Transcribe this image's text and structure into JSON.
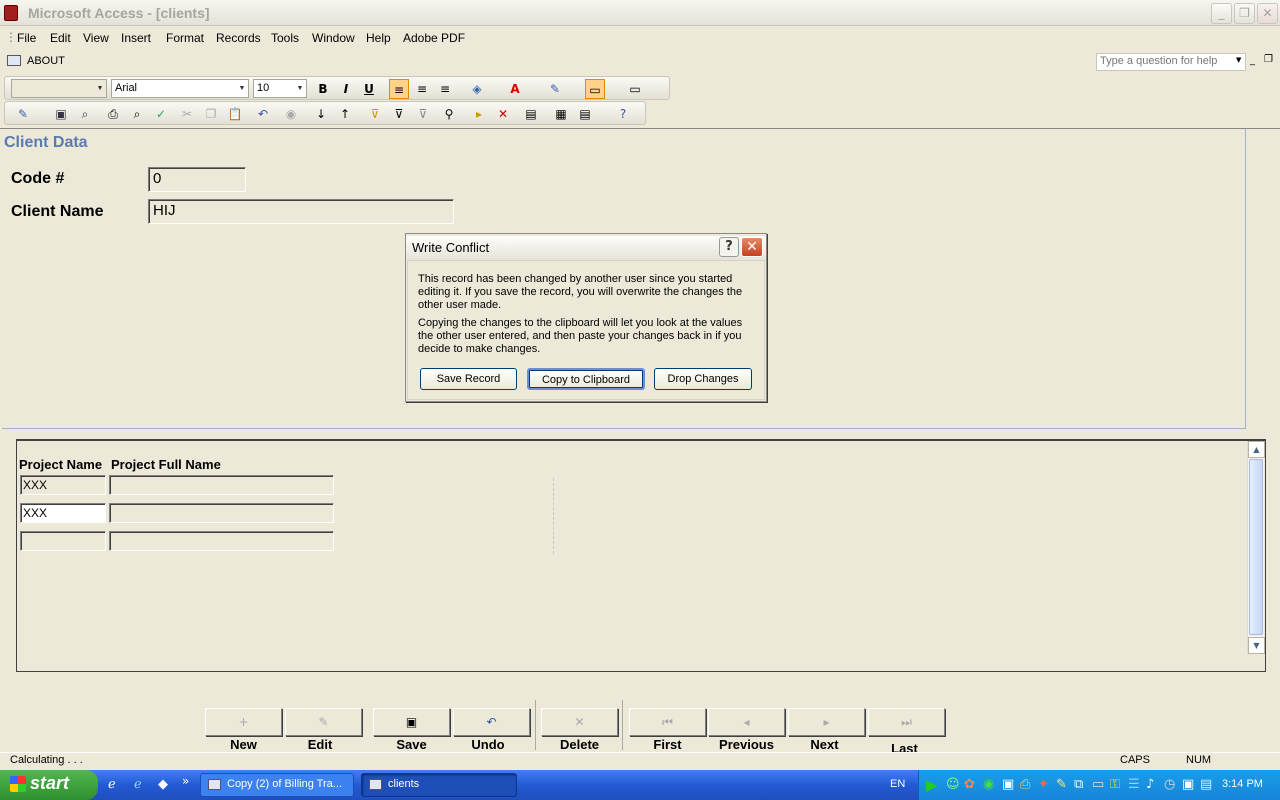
{
  "window": {
    "title": "Microsoft Access - [clients]"
  },
  "menu": [
    "File",
    "Edit",
    "View",
    "Insert",
    "Format",
    "Records",
    "Tools",
    "Window",
    "Help",
    "Adobe PDF"
  ],
  "about_label": "ABOUT",
  "help_placeholder": "Type a question for help",
  "format_toolbar": {
    "object_combo": "",
    "font": "Arial",
    "size": "10"
  },
  "form": {
    "header": "Client Data",
    "code_label": "Code #",
    "code_value": "0",
    "client_name_label": "Client Name",
    "client_name_value": "HIJ"
  },
  "subform": {
    "columns": [
      "Project Name",
      "Project Full Name"
    ],
    "rows": [
      {
        "project_name": "XXX",
        "project_full_name": ""
      },
      {
        "project_name": "XXX",
        "project_full_name": ""
      },
      {
        "project_name": "",
        "project_full_name": ""
      }
    ]
  },
  "dialog": {
    "title": "Write Conflict",
    "help": "?",
    "paragraph1": "This record has been changed by another user since you started editing it.  If you save the record, you will overwrite the changes the other user made.",
    "paragraph2": "Copying the changes to the clipboard will let you look at the values the other user entered, and then paste your changes back in if you decide to make changes.",
    "buttons": {
      "save": "Save Record",
      "copy": "Copy to Clipboard",
      "drop": "Drop Changes"
    }
  },
  "nav_buttons": [
    "New",
    "Edit",
    "Save",
    "Undo",
    "Delete",
    "First",
    "Previous",
    "Next",
    "Last"
  ],
  "status": {
    "text": "Calculating . . .",
    "caps": "CAPS",
    "num": "NUM"
  },
  "taskbar": {
    "start": "start",
    "tasks": [
      "Copy (2) of Billing Tra...",
      "clients"
    ],
    "lang": "EN",
    "clock": "3:14 PM"
  },
  "colors": {
    "accent": "#5a7ab0",
    "taskbar": "#2459d4",
    "start": "#3a9b3a"
  }
}
